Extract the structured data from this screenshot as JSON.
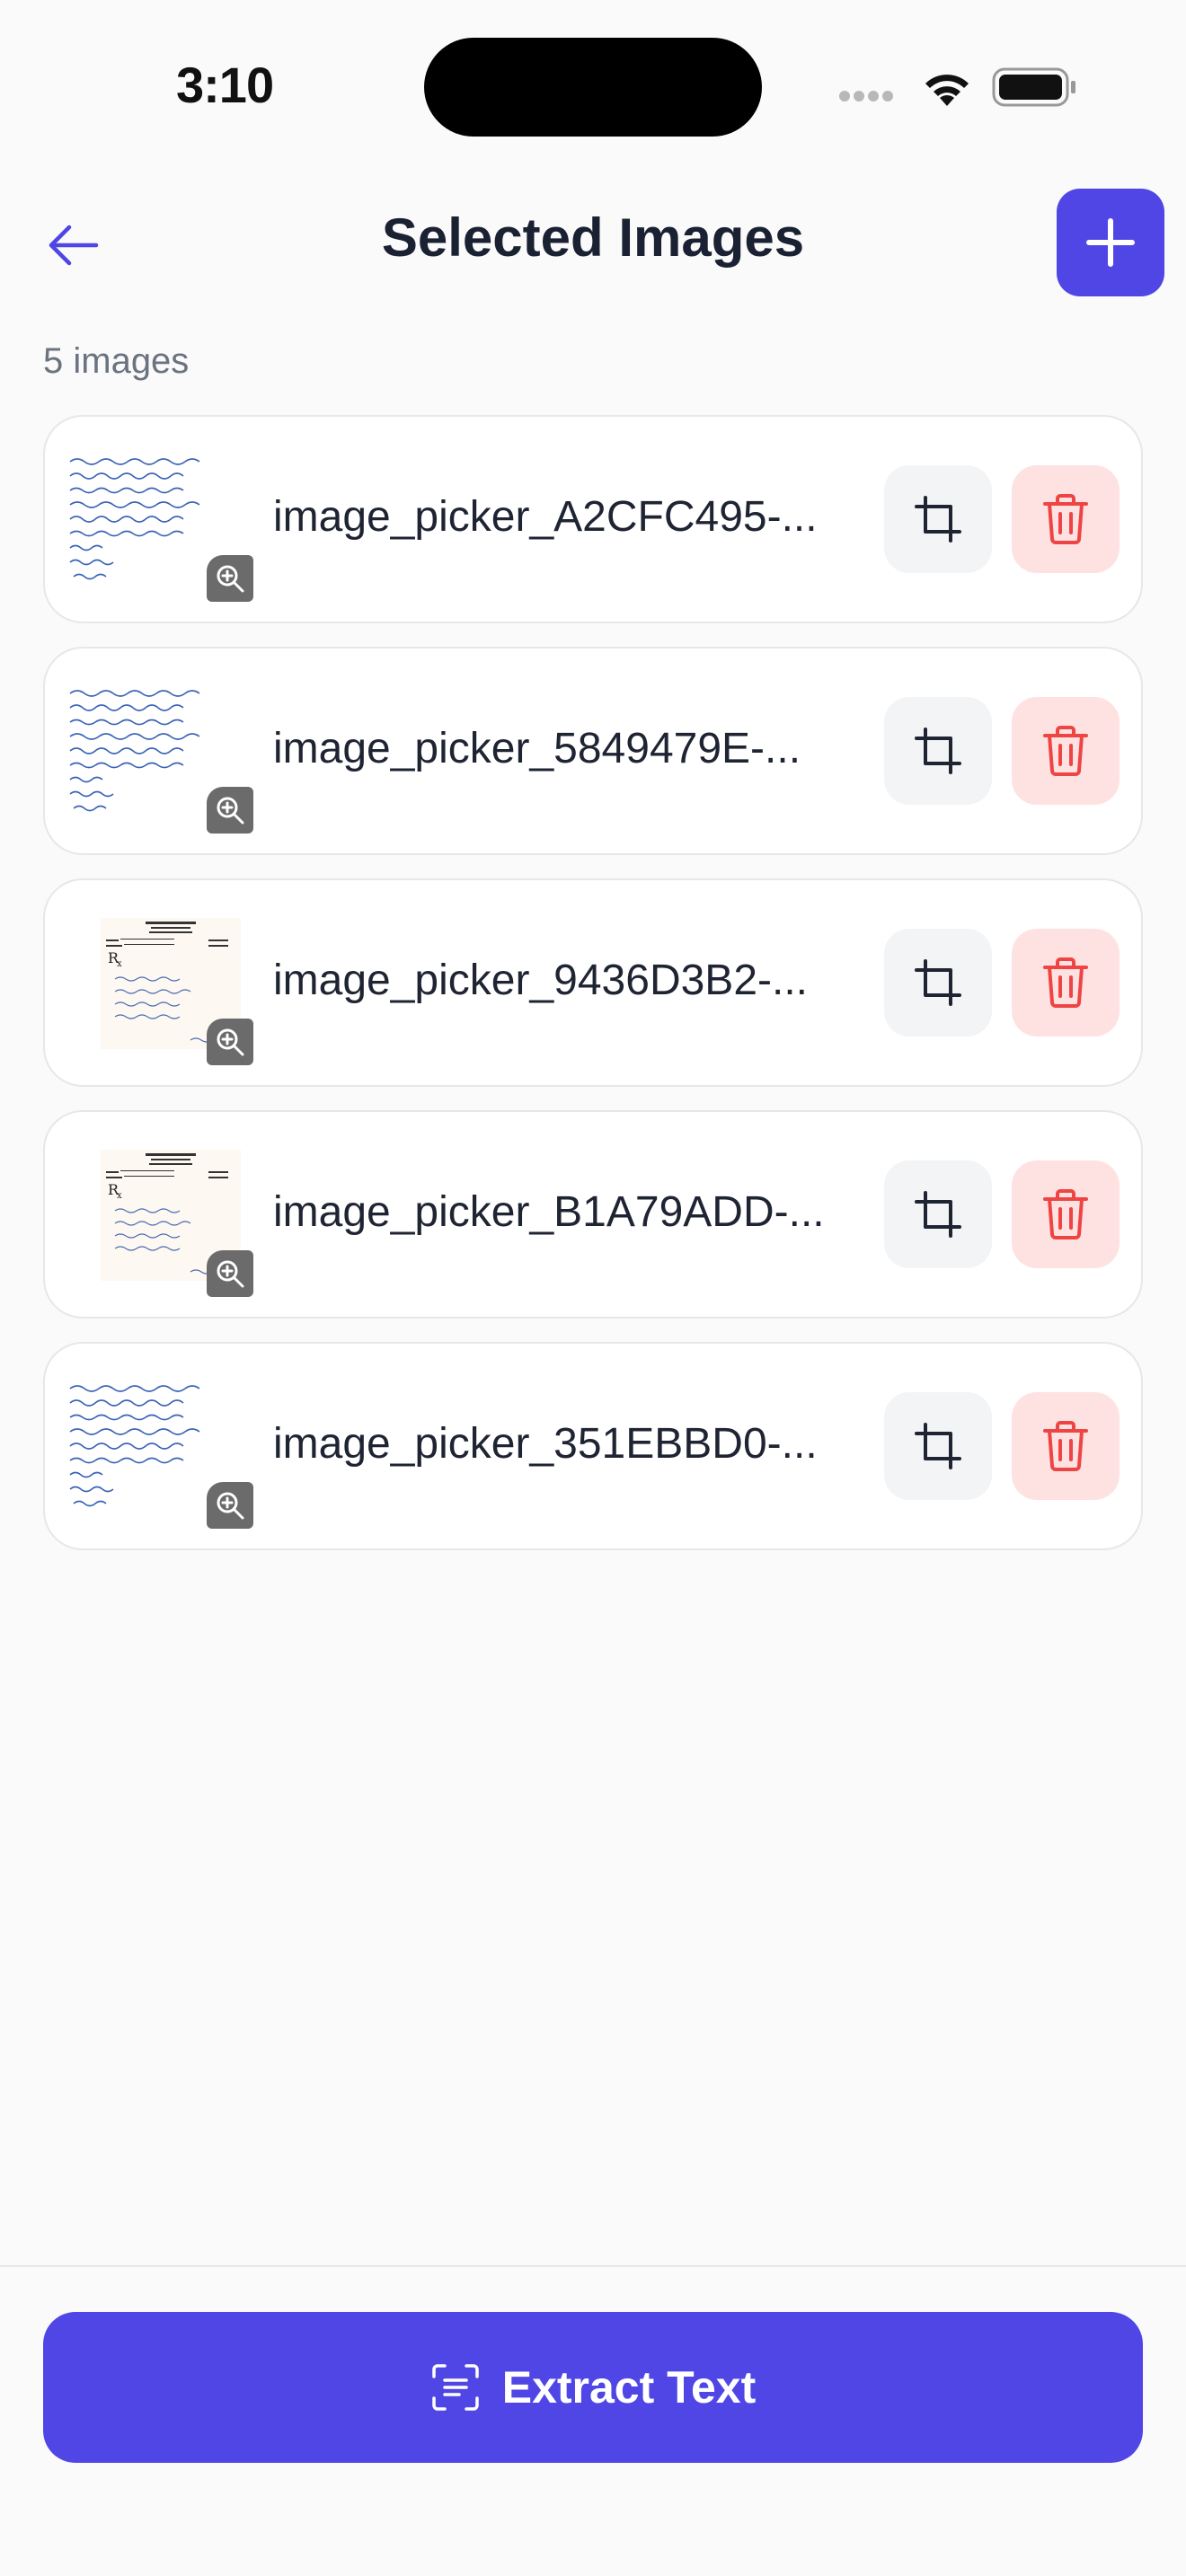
{
  "status_bar": {
    "time": "3:10"
  },
  "header": {
    "title": "Selected Images"
  },
  "images_count": "5 images",
  "images": [
    {
      "filename": "image_picker_A2CFC495-...",
      "kind": "handwriting"
    },
    {
      "filename": "image_picker_5849479E-...",
      "kind": "handwriting"
    },
    {
      "filename": "image_picker_9436D3B2-...",
      "kind": "prescription"
    },
    {
      "filename": "image_picker_B1A79ADD-...",
      "kind": "prescription"
    },
    {
      "filename": "image_picker_351EBBD0-...",
      "kind": "handwriting"
    }
  ],
  "footer": {
    "extract_label": "Extract Text"
  },
  "colors": {
    "accent": "#4f46e5",
    "delete_bg": "#fee2e2",
    "delete_icon": "#ef4444",
    "crop_bg": "#f3f4f6"
  }
}
